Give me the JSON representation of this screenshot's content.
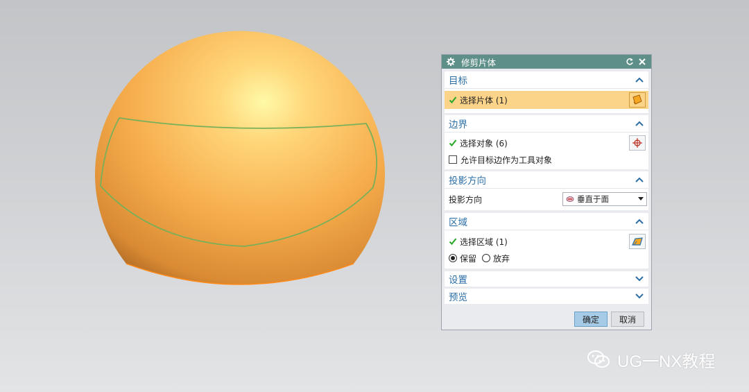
{
  "dialog": {
    "title": "修剪片体",
    "target": {
      "header": "目标",
      "select_label": "选择片体 (1)"
    },
    "boundary": {
      "header": "边界",
      "select_label": "选择对象 (6)",
      "checkbox_label": "允许目标边作为工具对象"
    },
    "projection": {
      "header": "投影方向",
      "row_label": "投影方向",
      "dropdown_value": "垂直于面"
    },
    "region": {
      "header": "区域",
      "select_label": "选择区域 (1)",
      "keep_label": "保留",
      "discard_label": "放弃",
      "selected": "keep"
    },
    "settings": {
      "header": "设置"
    },
    "preview": {
      "header": "预览"
    },
    "ok_label": "确定",
    "cancel_label": "取消"
  },
  "watermark": {
    "text": "UG一NX教程"
  },
  "colors": {
    "titlebar": "#5e8f88",
    "section_header": "#2b6ea6",
    "selection_highlight": "#fbd48a",
    "check": "#2eab2e",
    "sphere": "#f0a84a",
    "curve": "#78b05a"
  },
  "icons": [
    "gear-icon",
    "reset-icon",
    "close-icon",
    "chevron-up-icon",
    "chevron-down-icon",
    "check-icon",
    "sheet-body-icon",
    "crosshair-icon",
    "region-icon",
    "face-normal-icon",
    "wechat-icon"
  ]
}
